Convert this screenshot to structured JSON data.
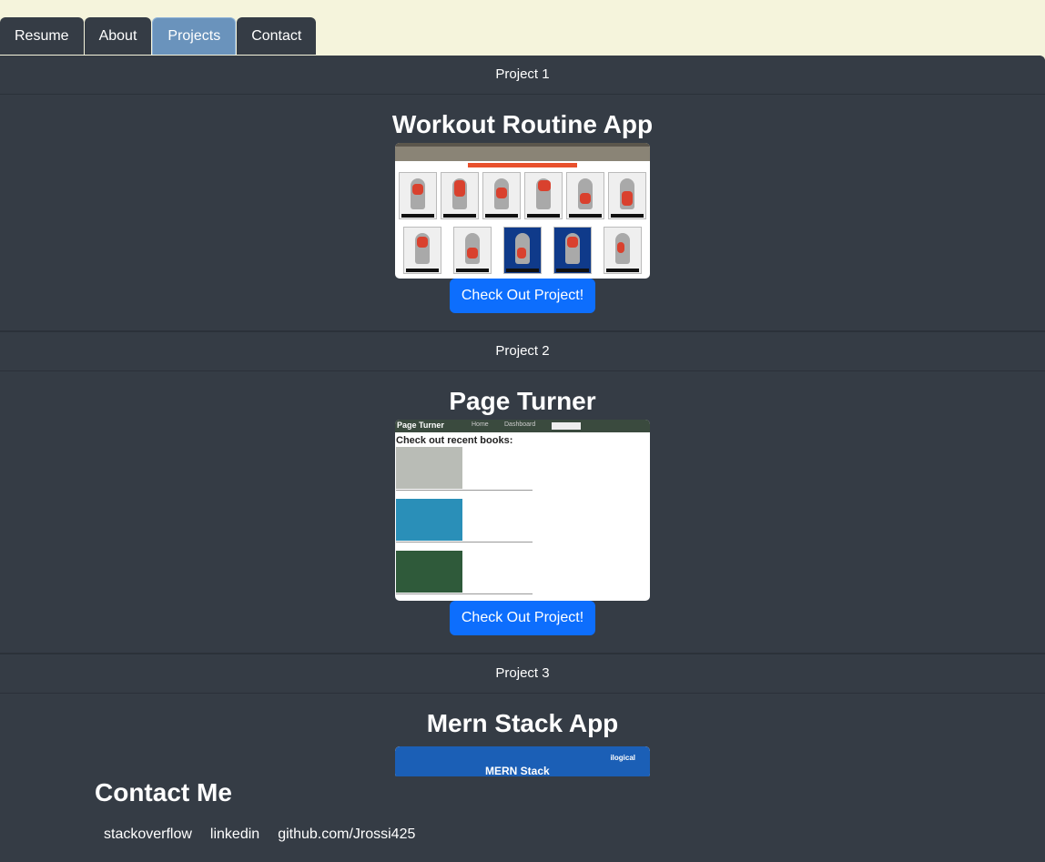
{
  "tabs": [
    "Resume",
    "About",
    "Projects",
    "Contact"
  ],
  "active_tab": "Projects",
  "projects": [
    {
      "header": "Project 1",
      "title": "Workout Routine App",
      "button": "Check Out Project!"
    },
    {
      "header": "Project 2",
      "title": "Page Turner",
      "button": "Check Out Project!"
    },
    {
      "header": "Project 3",
      "title": "Mern Stack App"
    }
  ],
  "pageturner_shot": {
    "brand": "Page Turner",
    "nav": [
      "Home",
      "Dashboard"
    ],
    "heading": "Check out recent books:"
  },
  "mern_shot": {
    "title": "MERN Stack",
    "logo": "ilogical"
  },
  "contact": {
    "title": "Contact Me",
    "links": [
      "stackoverflow",
      "linkedin",
      "github.com/Jrossi425"
    ]
  },
  "colors": {
    "panel": "#353c45",
    "page_bg": "#f5f4dc",
    "button": "#0d6efd",
    "active_tab": "#6a93bc"
  }
}
